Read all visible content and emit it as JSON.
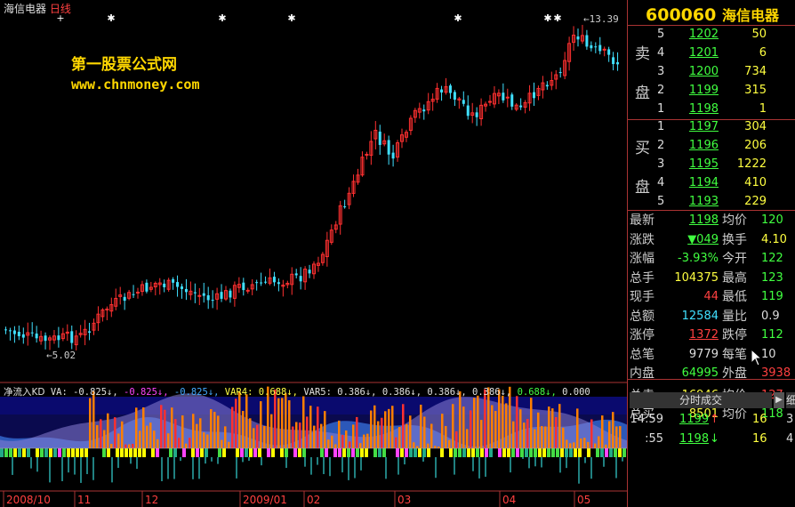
{
  "chart": {
    "header": {
      "name": "海信电器",
      "period": "日线"
    },
    "watermark": {
      "line1": "第一股票公式网",
      "line2": "www.chnmoney.com"
    },
    "annotations": {
      "high_label": "13.39",
      "low_label": "5.02"
    },
    "indicator": {
      "title": "净流入KD",
      "parts": [
        {
          "label": "VA: ",
          "value": "-0.825",
          "arrow": "↓",
          "color": "#e0e0e0"
        },
        {
          "label": "",
          "value": "-0.825",
          "arrow": "↓",
          "color": "#ff44ff"
        },
        {
          "label": "",
          "value": "-0.825",
          "arrow": "↓",
          "color": "#44aaff"
        },
        {
          "label": "VAR4: ",
          "value": "0.688",
          "arrow": "↓",
          "color": "#ffff44"
        },
        {
          "label": "VAR5: ",
          "value": "0.386",
          "arrow": "↓",
          "color": "#e0e0e0"
        },
        {
          "label": "",
          "value": "0.386",
          "arrow": "↓",
          "color": "#e0e0e0"
        },
        {
          "label": "",
          "value": "0.386",
          "arrow": "↓",
          "color": "#e0e0e0"
        },
        {
          "label": "",
          "value": "0.386",
          "arrow": "↓",
          "color": "#e0e0e0"
        },
        {
          "label": "",
          "value": "0.688",
          "arrow": "↓",
          "color": "#44ff44"
        },
        {
          "label": "",
          "value": "0.000",
          "arrow": "",
          "color": "#e0e0e0"
        }
      ]
    },
    "x_labels": [
      "2008/10",
      "11",
      "12",
      "2009/01",
      "02",
      "03",
      "04",
      "05"
    ]
  },
  "colors": {
    "up": "#ff3030",
    "down": "#40e0ff",
    "accent": "#ffd700",
    "border": "#aa3333",
    "volume_up": "#ff7f00"
  },
  "quote": {
    "code": "600060",
    "name": "海信电器",
    "sell_label": [
      "卖",
      "盘"
    ],
    "buy_label": [
      "买",
      "盘"
    ],
    "asks": [
      {
        "level": "5",
        "price": "1202",
        "vol": "50"
      },
      {
        "level": "4",
        "price": "1201",
        "vol": "6"
      },
      {
        "level": "3",
        "price": "1200",
        "vol": "734"
      },
      {
        "level": "2",
        "price": "1199",
        "vol": "315"
      },
      {
        "level": "1",
        "price": "1198",
        "vol": "1"
      }
    ],
    "bids": [
      {
        "level": "1",
        "price": "1197",
        "vol": "304"
      },
      {
        "level": "2",
        "price": "1196",
        "vol": "206"
      },
      {
        "level": "3",
        "price": "1195",
        "vol": "1222"
      },
      {
        "level": "4",
        "price": "1194",
        "vol": "410"
      },
      {
        "level": "5",
        "price": "1193",
        "vol": "229"
      }
    ],
    "stats": [
      {
        "l": "最新",
        "v": "1198",
        "vc": "#40ff40",
        "l2": "均价",
        "v2": "120",
        "v2c": "#40ff40",
        "ul": true
      },
      {
        "l": "涨跌",
        "v": "▼049",
        "vc": "#40ff40",
        "l2": "换手",
        "v2": "4.10",
        "v2c": "#ffff40",
        "ul": true
      },
      {
        "l": "涨幅",
        "v": "-3.93%",
        "vc": "#40ff40",
        "l2": "今开",
        "v2": "122",
        "v2c": "#40ff40"
      },
      {
        "l": "总手",
        "v": "104375",
        "vc": "#ffff40",
        "l2": "最高",
        "v2": "123",
        "v2c": "#40ff40"
      },
      {
        "l": "现手",
        "v": "44",
        "vc": "#ff4040",
        "l2": "最低",
        "v2": "119",
        "v2c": "#40ff40"
      },
      {
        "l": "总额",
        "v": "12584",
        "vc": "#40e0ff",
        "l2": "量比",
        "v2": "0.9",
        "v2c": "#dddddd"
      },
      {
        "l": "涨停",
        "v": "1372",
        "vc": "#ff4040",
        "l2": "跌停",
        "v2": "112",
        "v2c": "#40ff40",
        "ul": true
      },
      {
        "l": "总笔",
        "v": "9779",
        "vc": "#dddddd",
        "l2": "每笔",
        "v2": "10",
        "v2c": "#dddddd"
      },
      {
        "l": "内盘",
        "v": "64995",
        "vc": "#40ff40",
        "l2": "外盘",
        "v2": "3938",
        "v2c": "#ff4040"
      },
      {
        "l": "总卖",
        "v": "16946",
        "vc": "#ffff40",
        "l2": "均价",
        "v2": "127",
        "v2c": "#ff4040"
      },
      {
        "l": "总买",
        "v": "8501",
        "vc": "#ffff40",
        "l2": "均价",
        "v2": "118",
        "v2c": "#40ff40"
      }
    ],
    "tab_label": "分时成交",
    "tab2_label": "细",
    "ticks": [
      {
        "time": "14:59",
        "price": "1199",
        "arrow": "↑",
        "vol": "16",
        "extra": "3"
      },
      {
        "time": ":55",
        "price": "1198",
        "arrow": "↓",
        "vol": "16",
        "extra": "4"
      }
    ]
  }
}
